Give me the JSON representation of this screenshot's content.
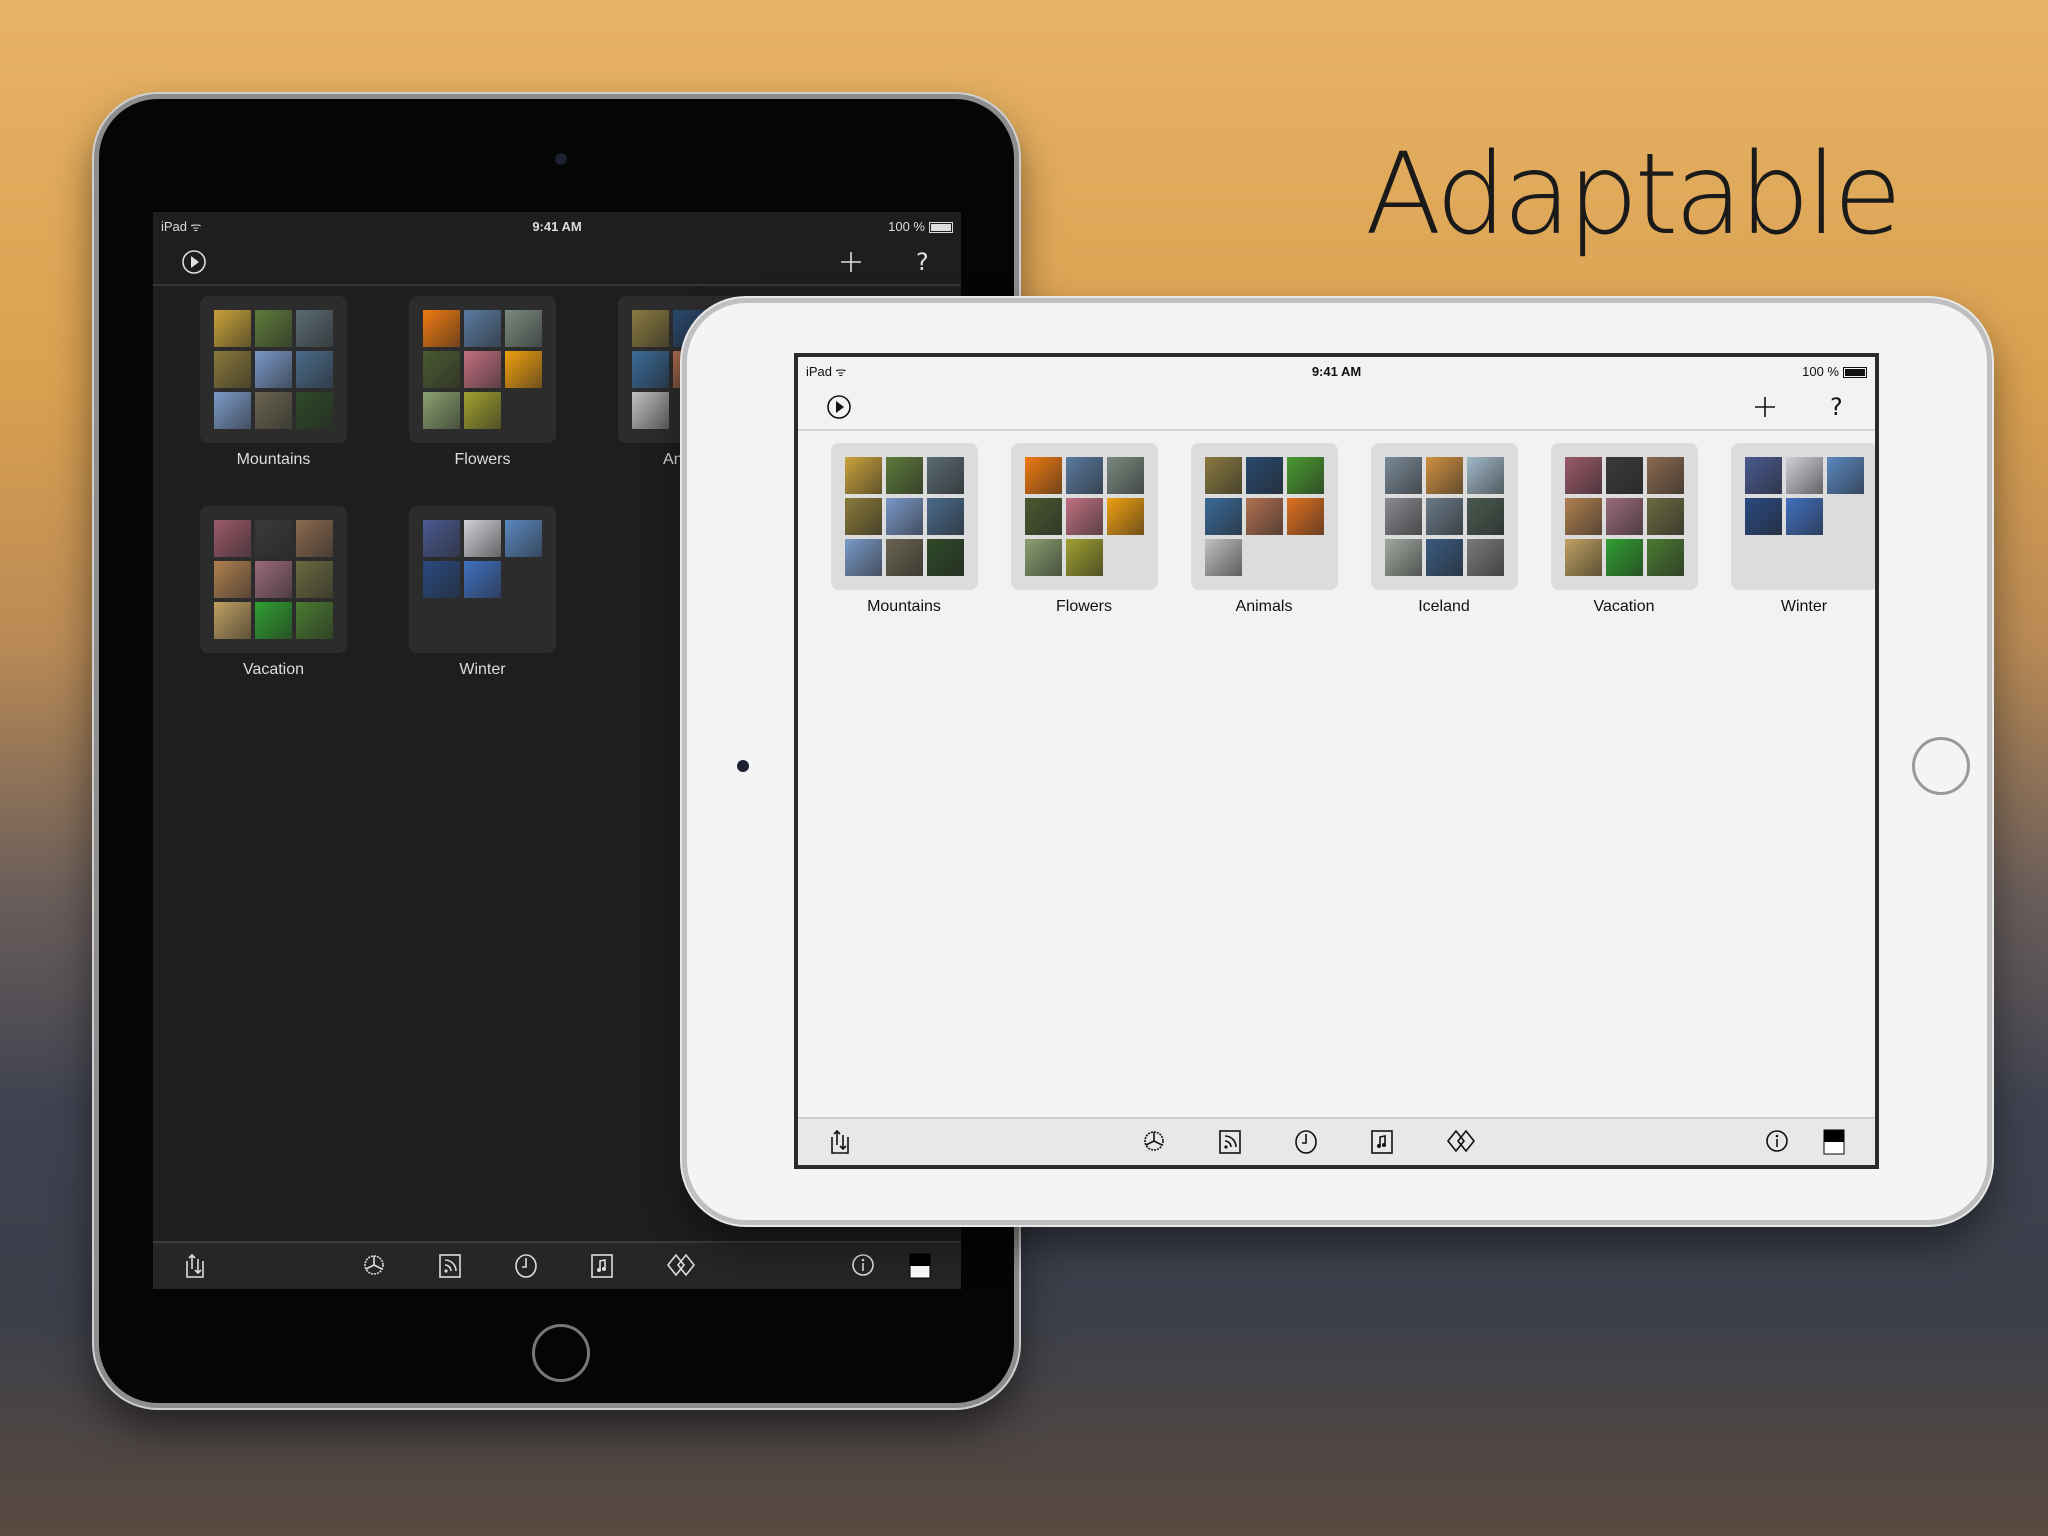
{
  "headline": "Adaptable",
  "status": {
    "device": "iPad",
    "time": "9:41 AM",
    "battery": "100 %"
  },
  "toolbar": {
    "play": "play-icon",
    "add": "plus-icon",
    "help": "question-icon"
  },
  "bottom_toolbar": [
    "share-icon",
    "settings-icon",
    "feed-icon",
    "clock-icon",
    "music-icon",
    "transition-icon",
    "info-icon",
    "theme-toggle-icon"
  ],
  "albums": [
    {
      "name": "Mountains",
      "thumbs": [
        "#c9a23a",
        "#5d7a3a",
        "#5a6a72",
        "#8a7a3a",
        "#7a98c8",
        "#4a6a8a",
        "#7a9ac8",
        "#6a6450",
        "#2e4a28"
      ]
    },
    {
      "name": "Flowers",
      "thumbs": [
        "#f07a10",
        "#5a7aa0",
        "#7a8a80",
        "#4a5a30",
        "#c07080",
        "#f0a010",
        "#8aa070",
        "#a0a030"
      ]
    },
    {
      "name": "Animals",
      "thumbs": [
        "#8a7a40",
        "#2a4a70",
        "#4a9a30",
        "#3a6a98",
        "#b07050",
        "#e07020",
        "#c0c0c0"
      ]
    },
    {
      "name": "Iceland",
      "thumbs": [
        "#7a8a98",
        "#d09040",
        "#a0b8c8",
        "#8a8a90",
        "#6a7a88",
        "#4a5a50",
        "#a0a8a0",
        "#3a5a80",
        "#7a7a7a"
      ]
    },
    {
      "name": "Vacation",
      "thumbs": [
        "#9a5a6a",
        "#3a3a3a",
        "#8a6a50",
        "#b08050",
        "#9a6a7a",
        "#6a6a40",
        "#c0a060",
        "#30a030",
        "#4a7a30"
      ]
    },
    {
      "name": "Winter",
      "thumbs": [
        "#4a5a90",
        "#d0d0d8",
        "#5a88c0",
        "#2a4a80",
        "#4070c0"
      ]
    }
  ],
  "dark_visible_albums": 6
}
